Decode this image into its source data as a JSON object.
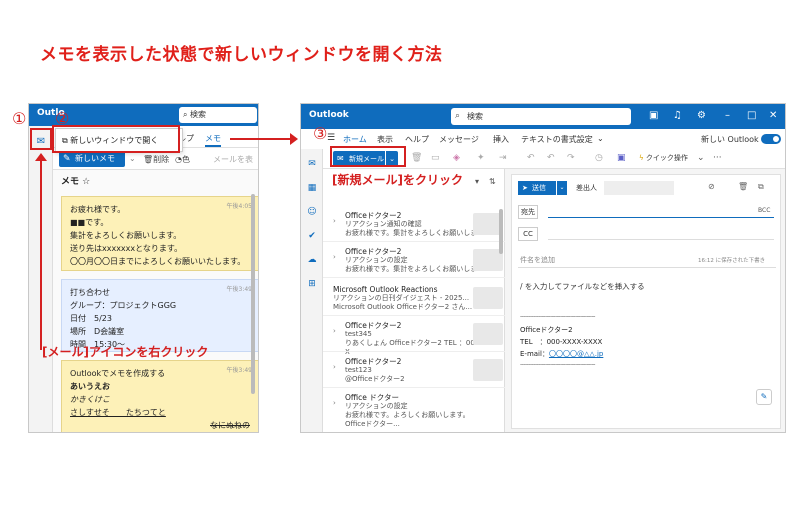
{
  "heading": "メモを表示した状態で新しいウィンドウを開く方法",
  "steps": {
    "one": "①",
    "two": "②",
    "three": "③"
  },
  "annotations": {
    "right_click_label": "[メール]アイコンを右クリック",
    "new_mail_label": "[新規メール]をクリック"
  },
  "left_window": {
    "title": "Outlo",
    "search": "検索",
    "context_menu_item": "新しいウィンドウで開く",
    "tab_partial": "ルプ",
    "tab_memo": "メモ",
    "new_memo_button": "新しいメモ",
    "delete_label": "削除",
    "color_label": "色",
    "mail_partial": "メールを表",
    "memo_header": "メモ",
    "memos": [
      {
        "timestamp": "午後4:05",
        "lines": [
          "お疲れ様です。",
          "■■です。",
          "集計をよろしくお願いします。",
          "送り先はxxxxxxxとなります。",
          "〇〇月〇〇日までによろしくお願いいたします。"
        ]
      },
      {
        "timestamp": "午後3:49",
        "lines": [
          "打ち合わせ",
          "グループ：プロジェクトGGG",
          "日付　5/23",
          "場所　D会議室",
          "時間　15:30～"
        ]
      },
      {
        "timestamp": "午後3:49",
        "lines": [
          "Outlookでメモを作成する",
          "あいうえお",
          "かきくけこ",
          "さしすせそ　　たちつてと",
          "なにぬねの"
        ]
      }
    ]
  },
  "right_window": {
    "title": "Outlook",
    "search": "検索",
    "tabs": [
      "ホーム",
      "表示",
      "ヘルプ",
      "メッセージ",
      "挿入",
      "テキストの書式設定"
    ],
    "new_outlook_label": "新しい Outlook",
    "new_mail_button": "新規メール",
    "quick_action": "クイック操作",
    "mail_list": [
      {
        "from": "Officeドクター2",
        "subject": "リアクション通知の確認",
        "preview": "お疲れ様です。集計をよろしくお願いしま"
      },
      {
        "from": "Officeドクター2",
        "subject": "リアクションの設定",
        "preview": "お疲れ様です。集計をよろしくお願いしま"
      },
      {
        "from": "Microsoft Outlook Reactions",
        "subject": "リアクションの日刊ダイジェスト - 2025...",
        "preview": "Microsoft Outlook Officeドクター2 さん..."
      },
      {
        "from": "Officeドクター2",
        "subject": "test345",
        "preview": "りあくしょん Officeドクター2 TEL ：000-X"
      },
      {
        "from": "Officeドクター2",
        "subject": "test123",
        "preview": "@Officeドクター2"
      },
      {
        "from": "Office ドクター",
        "subject": "リアクションの設定",
        "preview": "お疲れ様です。よろしくお願いします。Officeドクター..."
      }
    ],
    "compose": {
      "send": "送信",
      "from_label": "差出人",
      "to_label": "宛先",
      "bcc_label": "BCC",
      "cc_label": "CC",
      "subject_placeholder": "件名を追加",
      "saved_text": "16:12 に保存された下書き",
      "body_hint": "/ を入力してファイルなどを挿入する",
      "sig_dashes": "---------------------------------------------",
      "sig_name": "Officeドクター2",
      "sig_tel": "TEL　：000-XXXX-XXXX",
      "sig_email_label": "E-mail：",
      "sig_email": "〇〇〇〇@△△.jp"
    }
  }
}
